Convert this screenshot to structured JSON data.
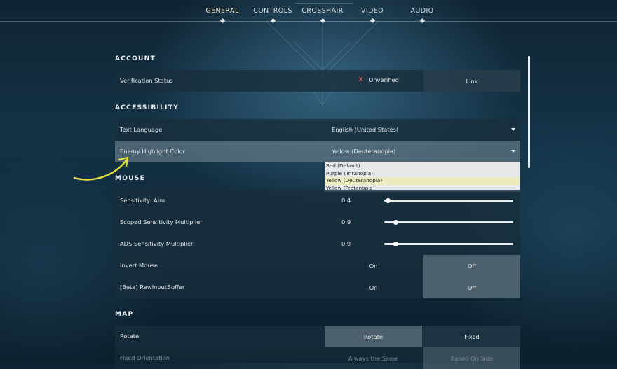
{
  "tabs": [
    {
      "label": "GENERAL",
      "active": true
    },
    {
      "label": "CONTROLS",
      "active": false
    },
    {
      "label": "CROSSHAIR",
      "active": false
    },
    {
      "label": "VIDEO",
      "active": false
    },
    {
      "label": "AUDIO",
      "active": false
    }
  ],
  "account": {
    "title": "ACCOUNT",
    "verification": {
      "label": "Verification Status",
      "status": "Unverified",
      "link_label": "Link"
    }
  },
  "accessibility": {
    "title": "ACCESSIBILITY",
    "text_language": {
      "label": "Text Language",
      "value": "English (United States)"
    },
    "enemy_highlight": {
      "label": "Enemy Highlight Color",
      "value": "Yellow (Deuteranopia)",
      "options": [
        "Red (Default)",
        "Purple (Tritanopia)",
        "Yellow (Deuteranopia)",
        "Yellow (Protanopia)"
      ],
      "selected_option": "Yellow (Deuteranopia)"
    }
  },
  "mouse": {
    "title": "MOUSE",
    "sensitivity_aim": {
      "label": "Sensitivity: Aim",
      "value": "0.4",
      "slider_fraction": 0.03
    },
    "scoped_multiplier": {
      "label": "Scoped Sensitivity Multiplier",
      "value": "0.9",
      "slider_fraction": 0.09
    },
    "ads_multiplier": {
      "label": "ADS Sensitivity Multiplier",
      "value": "0.9",
      "slider_fraction": 0.09
    },
    "invert_mouse": {
      "label": "Invert Mouse",
      "on_label": "On",
      "off_label": "Off",
      "selected": "Off"
    },
    "raw_input": {
      "label": "[Beta] RawInputBuffer",
      "on_label": "On",
      "off_label": "Off",
      "selected": "Off"
    }
  },
  "map": {
    "title": "MAP",
    "rotate": {
      "label": "Rotate",
      "option_a": "Rotate",
      "option_b": "Fixed",
      "selected": "Rotate"
    },
    "fixed_orientation": {
      "label": "Fixed Orientation",
      "option_a": "Always the Same",
      "option_b": "Based On Side"
    }
  },
  "colors": {
    "accent_x": "#e3515d",
    "annotation_arrow": "#e6df3a",
    "dropdown_selected": "#ecebbd"
  }
}
